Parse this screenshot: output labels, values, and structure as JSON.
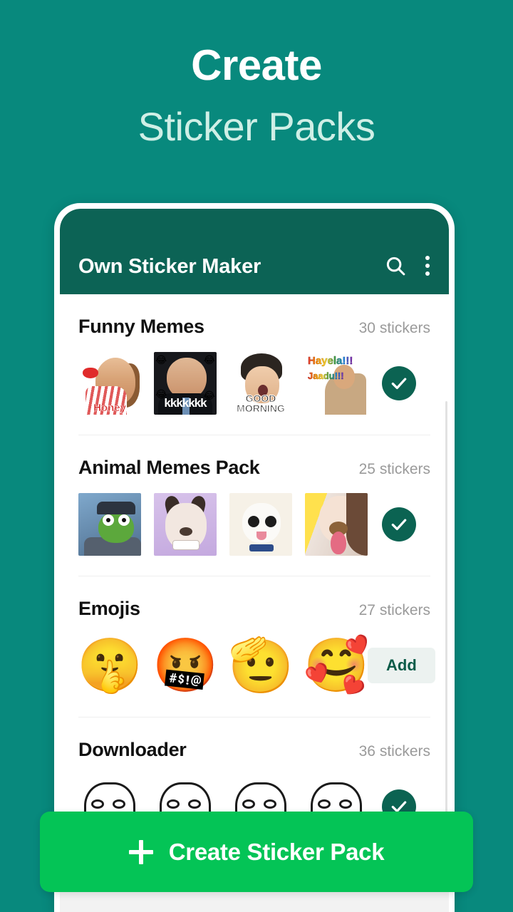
{
  "hero": {
    "line1": "Create",
    "line2": "Sticker Packs"
  },
  "colors": {
    "background": "#08897D",
    "appbar": "#0C6355",
    "cta": "#04C456",
    "check_circle": "#0B6352",
    "add_button_bg": "#ECF2F0",
    "add_button_text": "#0B5C49",
    "hero_line2": "#CFEFE6"
  },
  "appbar": {
    "title": "Own Sticker Maker",
    "search_icon": "search-icon",
    "more_icon": "overflow-menu-icon"
  },
  "packs": [
    {
      "title": "Funny Memes",
      "count": "30 stickers",
      "action": "added",
      "action_label": "",
      "thumbs": [
        {
          "kind": "photo",
          "art": "honey",
          "caption": "Honey"
        },
        {
          "kind": "photo",
          "art": "kkk",
          "caption": "kkkkkkk"
        },
        {
          "kind": "photo",
          "art": "goodmorning",
          "caption_line1": "GOOD",
          "caption_line2": "MORNING"
        },
        {
          "kind": "photo",
          "art": "hayela",
          "caption_line1": "Hayela!!!",
          "caption_line2": "Jaadu!!!"
        }
      ]
    },
    {
      "title": "Animal Memes Pack",
      "count": "25 stickers",
      "action": "added",
      "action_label": "",
      "thumbs": [
        {
          "kind": "photo",
          "art": "pepe",
          "caption": ""
        },
        {
          "kind": "photo",
          "art": "husky",
          "caption": ""
        },
        {
          "kind": "photo",
          "art": "cat",
          "caption": ""
        },
        {
          "kind": "photo",
          "art": "dogfilter",
          "caption": ""
        }
      ]
    },
    {
      "title": "Emojis",
      "count": "27 stickers",
      "action": "add",
      "action_label": "Add",
      "thumbs": [
        {
          "kind": "emoji",
          "glyph": "🤫"
        },
        {
          "kind": "emoji",
          "glyph": "🤬"
        },
        {
          "kind": "emoji",
          "glyph": "🫡"
        },
        {
          "kind": "emoji",
          "glyph": "🥰"
        }
      ]
    },
    {
      "title": "Downloader",
      "count": "36 stickers",
      "action": "added",
      "action_label": "",
      "thumbs": [
        {
          "kind": "photo",
          "art": "troll",
          "caption": ""
        },
        {
          "kind": "photo",
          "art": "troll",
          "caption": ""
        },
        {
          "kind": "photo",
          "art": "troll",
          "caption": ""
        },
        {
          "kind": "photo",
          "art": "troll",
          "caption": ""
        }
      ]
    }
  ],
  "cta": {
    "label": "Create Sticker Pack",
    "icon": "plus-icon"
  }
}
